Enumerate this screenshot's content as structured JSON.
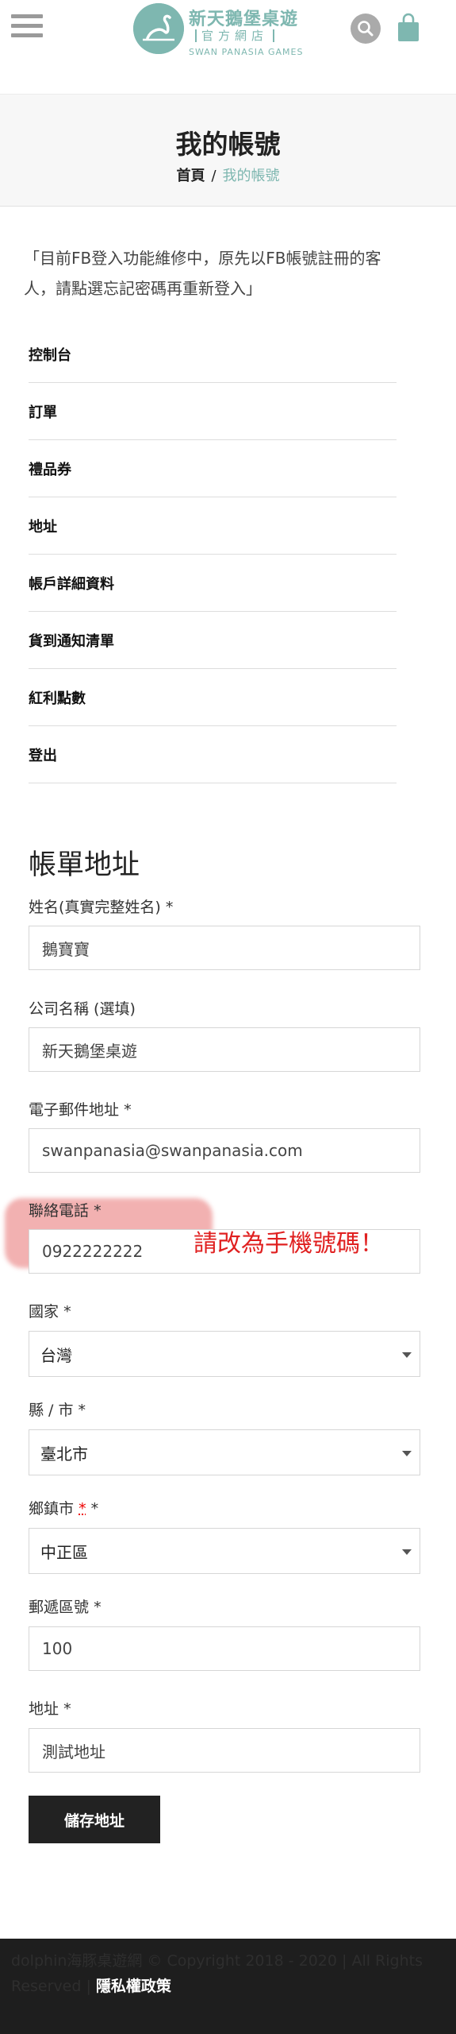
{
  "header": {
    "logo_name": "新天鵝堡桌遊",
    "logo_sub": "官方網店",
    "logo_en": "SWAN PANASIA GAMES",
    "menu_icon": "hamburger-menu-icon",
    "search_icon": "search-icon",
    "cart_icon": "shopping-bag-icon"
  },
  "page": {
    "title": "我的帳號",
    "breadcrumb_home": "首頁",
    "breadcrumb_sep": "/",
    "breadcrumb_current": "我的帳號"
  },
  "notice": "「目前FB登入功能維修中，原先以FB帳號註冊的客人，請點選忘記密碼再重新登入」",
  "account_nav": {
    "items": [
      "控制台",
      "訂單",
      "禮品券",
      "地址",
      "帳戶詳細資料",
      "貨到通知清單",
      "紅利點數",
      "登出"
    ]
  },
  "form": {
    "section_title": "帳單地址",
    "name_label": "姓名(真實完整姓名)",
    "name_value": "鵝寶寶",
    "company_label": "公司名稱 (選填)",
    "company_value": "新天鵝堡桌遊",
    "email_label": "電子郵件地址",
    "email_value": "swanpanasia@swanpanasia.com",
    "phone_label": "聯絡電話",
    "phone_value": "0922222222",
    "country_label": "國家",
    "country_value": "台灣",
    "county_label": "縣 / 市",
    "county_value": "臺北市",
    "township_label": "鄉鎮市",
    "township_value": "中正區",
    "zip_label": "郵遞區號",
    "zip_value": "100",
    "address_label": "地址",
    "address_value": "測試地址",
    "required_mark": "*",
    "save_label": "儲存地址"
  },
  "annotation": "請改為手機號碼！",
  "footer": {
    "copyright": "dolphin海豚桌遊網 © Copyright 2018 - 2020 | All Rights Reserved |",
    "privacy": "隱私權政策"
  },
  "colors": {
    "brand": "#7eb7b0",
    "annotation": "#e02020",
    "button": "#222222"
  }
}
